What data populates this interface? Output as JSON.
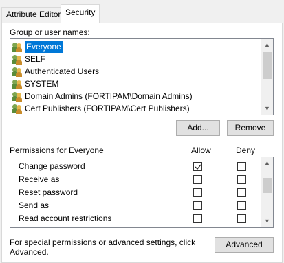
{
  "tabs": [
    {
      "label": "Attribute Editor"
    },
    {
      "label": "Security"
    }
  ],
  "group_section": {
    "label": "Group or user names:",
    "items": [
      {
        "label": "Everyone",
        "selected": true
      },
      {
        "label": "SELF"
      },
      {
        "label": "Authenticated Users"
      },
      {
        "label": "SYSTEM"
      },
      {
        "label": "Domain Admins (FORTIPAM\\Domain Admins)"
      },
      {
        "label": "Cert Publishers (FORTIPAM\\Cert Publishers)"
      }
    ],
    "add_label": "Add...",
    "remove_label": "Remove"
  },
  "permissions": {
    "title": "Permissions for Everyone",
    "allow_header": "Allow",
    "deny_header": "Deny",
    "rows": [
      {
        "name": "Change password",
        "allow": true,
        "deny": false
      },
      {
        "name": "Receive as",
        "allow": false,
        "deny": false
      },
      {
        "name": "Reset password",
        "allow": false,
        "deny": false
      },
      {
        "name": "Send as",
        "allow": false,
        "deny": false
      },
      {
        "name": "Read account restrictions",
        "allow": false,
        "deny": false
      }
    ]
  },
  "footer": {
    "text_line1": "For special permissions or advanced settings, click",
    "text_line2": "Advanced.",
    "advanced_label": "Advanced"
  },
  "colors": {
    "selection": "#0078d7",
    "button_face": "#e1e1e1",
    "window_bg": "#f0f0f0"
  }
}
